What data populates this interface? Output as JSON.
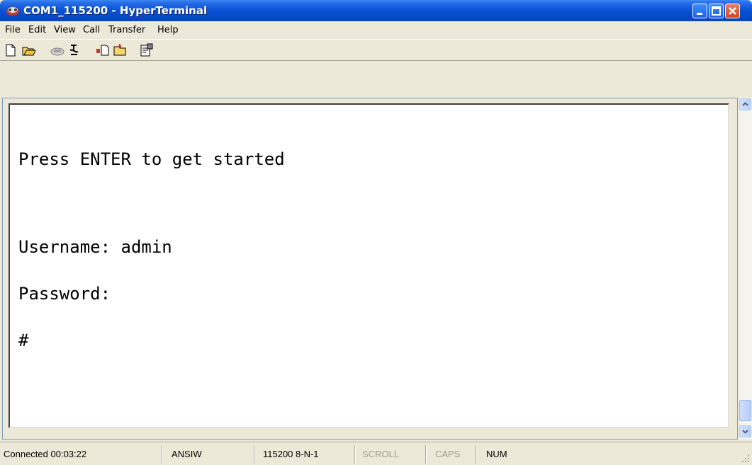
{
  "window": {
    "title": "COM1_115200 - HyperTerminal"
  },
  "menu": {
    "items": [
      "File",
      "Edit",
      "View",
      "Call",
      "Transfer",
      "Help"
    ]
  },
  "toolbar": {
    "buttons": [
      "new-icon",
      "open-icon",
      "call-icon",
      "disconnect-icon",
      "send-icon",
      "receive-icon",
      "properties-icon"
    ]
  },
  "terminal": {
    "lines": [
      "Press ENTER to get started",
      "",
      "Username: admin",
      "Password:",
      "#"
    ]
  },
  "status": {
    "connected": "Connected 00:03:22",
    "emulation": "ANSIW",
    "settings": "115200 8-N-1",
    "scroll": "SCROLL",
    "caps": "CAPS",
    "num": "NUM"
  },
  "colors": {
    "titlebar": "#0a55d8",
    "chrome": "#ece9d8",
    "terminal_bg": "#ffffff",
    "dim_status": "#a09d90"
  }
}
